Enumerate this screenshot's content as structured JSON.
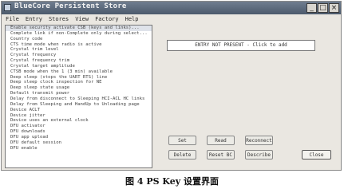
{
  "window": {
    "title": "BlueCore Persistent Store",
    "buttons": [
      "_",
      "□",
      "×"
    ]
  },
  "menu": [
    "File",
    "Entry",
    "Stores",
    "View",
    "Factory",
    "Help"
  ],
  "list_items": [
    "Enable security activate CSB (keys and links)...",
    "Complete link if non-Complete only during select...",
    "Country code",
    "CTS time mode when radio is active",
    "Crystal trim level",
    "Crystal frequency",
    "Crystal frequency trim",
    "Crystal target amplitude",
    "CTSB mode when the 1 (3 min) available",
    "Deep sleep (stops the UART RTS) line",
    "Deep sleep clock inspection for NE",
    "Deep sleep state usage",
    "Default transmit power",
    "Delay from disconnect to Sleeping HCI-ACL HC links",
    "Delay from Sleeping and HandUp to Unloading page",
    "Device ACLT",
    "Device jitter",
    "Device uses an external clock",
    "DFU activator",
    "DFU downloads",
    "DFU app upload",
    "DFU default session",
    "DFU enable"
  ],
  "value_text": "ENTRY NOT PRESENT - Click to add",
  "buttons": {
    "set": "Set",
    "read": "Read",
    "reconnect": "Reconnect",
    "delete": "Delete",
    "reset": "Reset BC",
    "describe": "Describe",
    "close": "Close"
  },
  "caption": "图 4 PS Key 设置界面"
}
